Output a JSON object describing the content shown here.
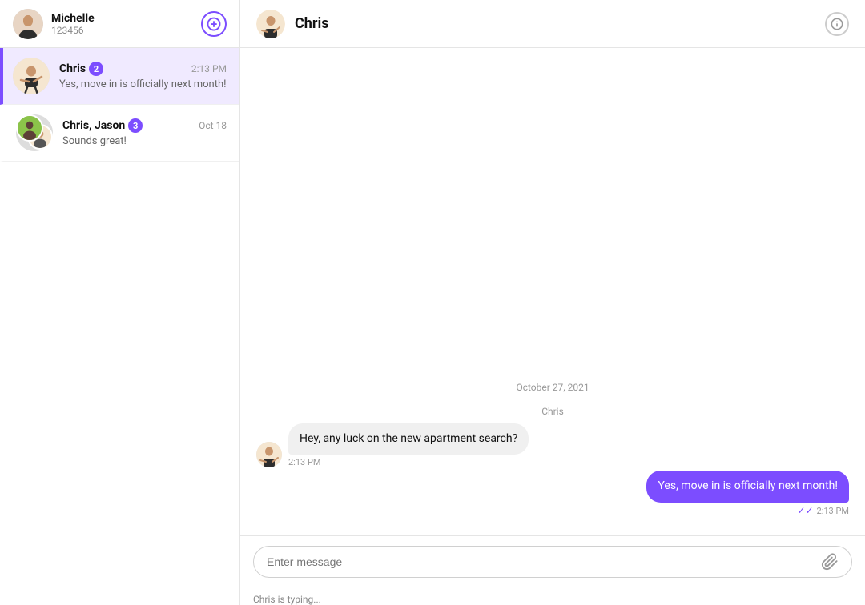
{
  "sidebar": {
    "user": {
      "name": "Michelle",
      "id": "123456"
    },
    "new_chat_label": "+",
    "conversations": [
      {
        "id": "conv-chris",
        "name": "Chris",
        "badge": "2",
        "time": "2:13 PM",
        "preview": "Yes, move in is officially next month!",
        "active": true
      },
      {
        "id": "conv-chris-jason",
        "name": "Chris, Jason",
        "badge": "3",
        "time": "Oct 18",
        "preview": "Sounds great!",
        "active": false
      }
    ]
  },
  "chat": {
    "contact_name": "Chris",
    "date_label": "October 27, 2021",
    "messages": [
      {
        "id": "msg1",
        "sender": "Chris",
        "sender_label": "Chris",
        "type": "other",
        "text": "Hey, any luck on the new apartment search?",
        "time": "2:13 PM",
        "show_check": false
      },
      {
        "id": "msg2",
        "sender": "me",
        "type": "mine",
        "text": "Yes, move in is officially next month!",
        "time": "2:13 PM",
        "show_check": true
      }
    ],
    "input_placeholder": "Enter message",
    "typing_indicator": "Chris is typing..."
  }
}
